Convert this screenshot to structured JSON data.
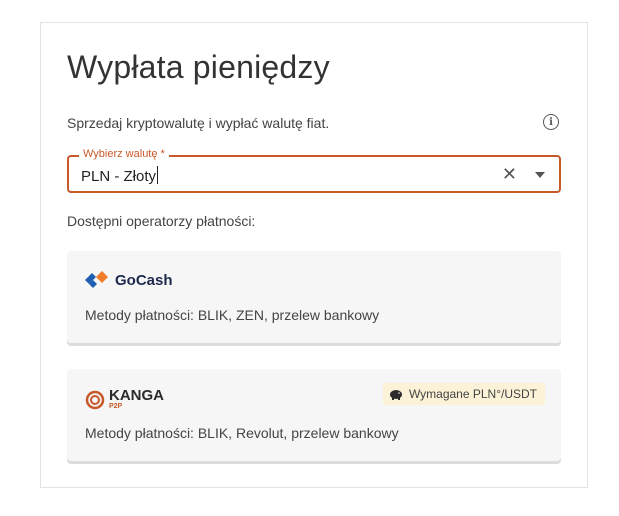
{
  "page": {
    "title": "Wypłata pieniędzy",
    "subtitle": "Sprzedaj kryptowalutę i wypłać walutę fiat."
  },
  "currency_select": {
    "label": "Wybierz walutę *",
    "value": "PLN - Złoty"
  },
  "operators": {
    "heading": "Dostępni operatorzy płatności:",
    "items": [
      {
        "name": "GoCash",
        "methods": "Metody płatności: BLIK, ZEN, przelew bankowy"
      },
      {
        "name": "KANGA",
        "sub": "P2P",
        "methods": "Metody płatności: BLIK, Revolut, przelew bankowy",
        "badge": "Wymagane PLN°/USDT"
      }
    ]
  },
  "colors": {
    "accent": "#c85a2a",
    "gocash_orange": "#f07c29",
    "gocash_blue": "#1e5fb4",
    "badge_bg": "#fbf2d7"
  }
}
